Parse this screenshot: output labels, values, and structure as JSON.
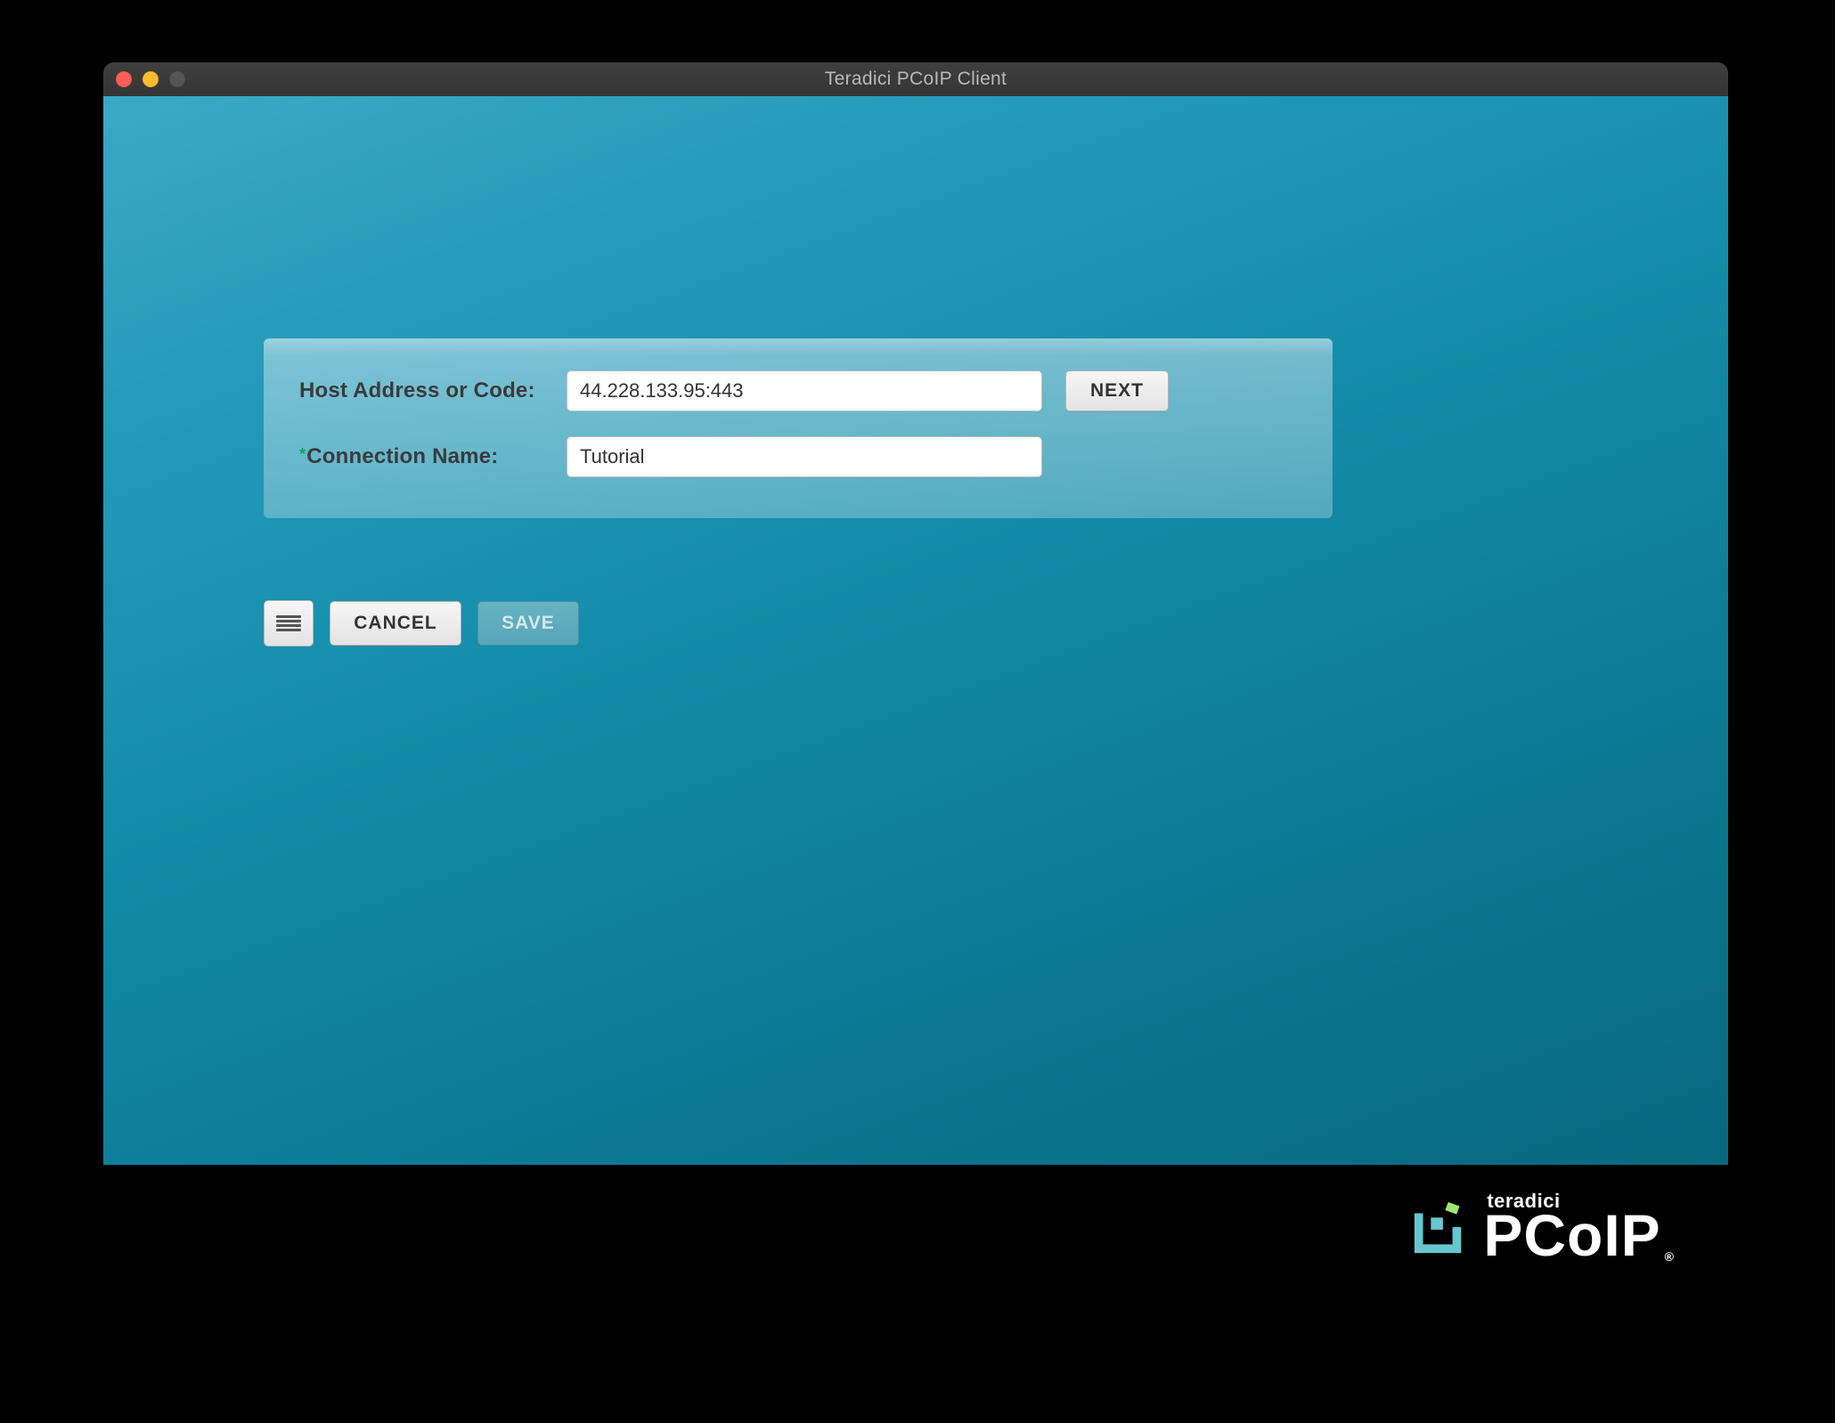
{
  "window": {
    "title": "Teradici PCoIP Client"
  },
  "form": {
    "host_label": "Host Address or Code:",
    "host_value": "44.228.133.95:443",
    "name_label": "Connection Name:",
    "name_value": "Tutorial",
    "next_label": "NEXT"
  },
  "actions": {
    "cancel_label": "CANCEL",
    "save_label": "SAVE"
  },
  "branding": {
    "company": "teradici",
    "product": "PCoIP"
  }
}
